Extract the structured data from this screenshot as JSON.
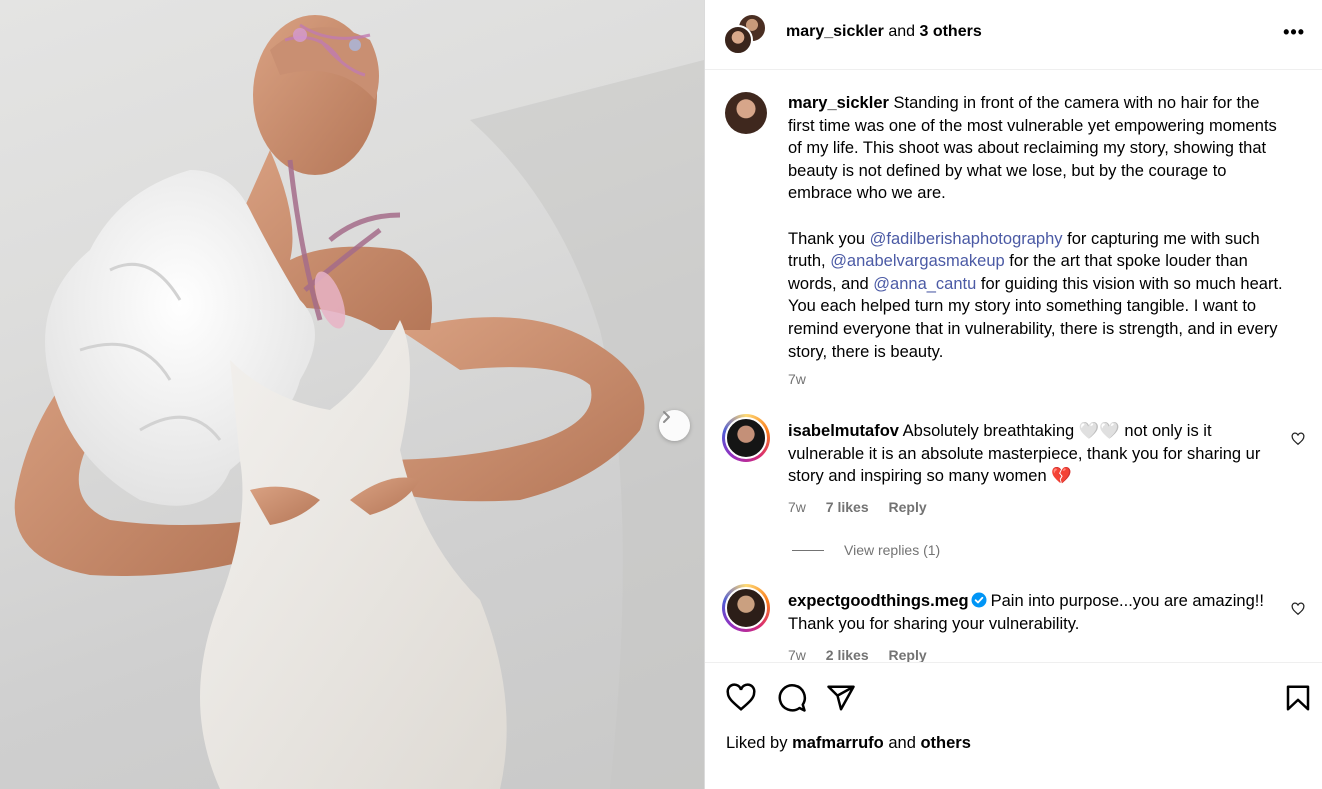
{
  "post": {
    "header": {
      "username": "mary_sickler",
      "others_text": "and",
      "others_count": "3 others",
      "more_label": "•••"
    },
    "caption": {
      "username": "mary_sickler",
      "para1": "Standing in front of the camera with no hair for the first time was one of the most vulnerable yet empowering moments of my life. This shoot was about reclaiming my story, showing that beauty is not defined by what we lose, but by the courage to embrace who we are.",
      "p2_a": "Thank you ",
      "mention1": "@fadilberishaphotography",
      "p2_b": " for capturing me with such truth, ",
      "mention2": "@anabelvargasmakeup",
      "p2_c": " for the art that spoke louder than words, and ",
      "mention3": "@anna_cantu",
      "p2_d": " for guiding this vision with so much heart. You each helped turn my story into something tangible. I want to remind everyone that in vulnerability, there is strength, and in every story, there is beauty.",
      "time": "7w"
    },
    "comments": [
      {
        "username": "isabelmutafov",
        "text": "Absolutely breathtaking 🤍🤍 not only is it vulnerable it is an absolute masterpiece, thank you for sharing ur story and inspiring so many women 💔",
        "time": "7w",
        "likes": "7 likes",
        "reply": "Reply",
        "view_replies": "View replies (1)"
      },
      {
        "username": "expectgoodthings.meg",
        "verified": true,
        "text": "Pain into purpose...you are amazing!! Thank you for sharing your vulnerability.",
        "time": "7w",
        "likes": "2 likes",
        "reply": "Reply"
      }
    ],
    "actions": {
      "icons": [
        "heart-icon",
        "comment-icon",
        "share-icon",
        "bookmark-icon"
      ]
    },
    "liked_by": {
      "prefix": "Liked by",
      "user": "mafmarrufo",
      "conj": "and",
      "others": "others"
    }
  },
  "colors": {
    "mention": "#4b5aa5",
    "muted": "#737373",
    "verified": "#0095f6"
  }
}
